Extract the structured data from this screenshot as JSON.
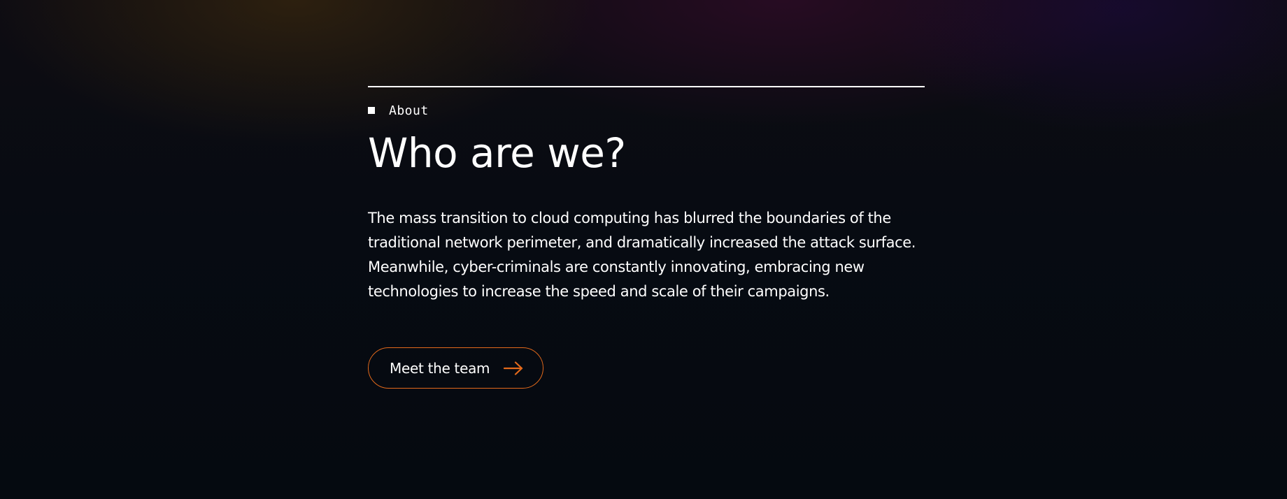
{
  "section": {
    "eyebrow_icon": "square-bullet-icon",
    "eyebrow_label": "About",
    "title": "Who are we?",
    "body": "The mass transition to cloud computing has blurred the boundaries of the traditional network perimeter, and dramatically increased the attack surface. Meanwhile, cyber-criminals are constantly innovating, embracing new technologies to increase the speed and scale of their campaigns."
  },
  "cta": {
    "label": "Meet the team",
    "icon": "arrow-right-icon"
  },
  "colors": {
    "accent": "#e3691b",
    "text": "#ffffff",
    "background": "#050a10"
  }
}
